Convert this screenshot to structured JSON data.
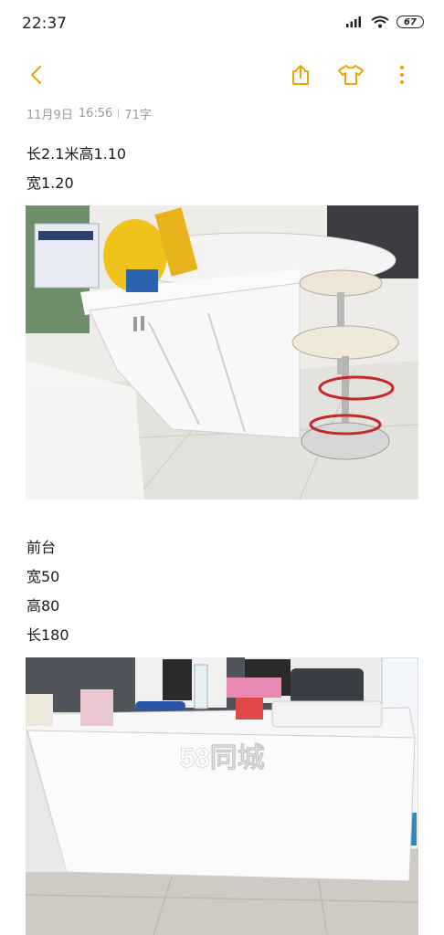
{
  "status": {
    "time": "22:37",
    "battery": "67"
  },
  "toolbar": {
    "back_icon": "chevron-left-icon",
    "share_icon": "share-icon",
    "theme_icon": "tshirt-icon",
    "more_icon": "more-vertical-icon",
    "accent_color": "#f0a30a"
  },
  "note": {
    "date": "11月9日",
    "time": "16:56",
    "char_count": "71字",
    "lines1": [
      "长2.1米高1.10",
      "宽1.20"
    ],
    "lines2": [
      "前台",
      "宽50",
      "高80",
      "长180"
    ],
    "watermark": "58同城"
  }
}
